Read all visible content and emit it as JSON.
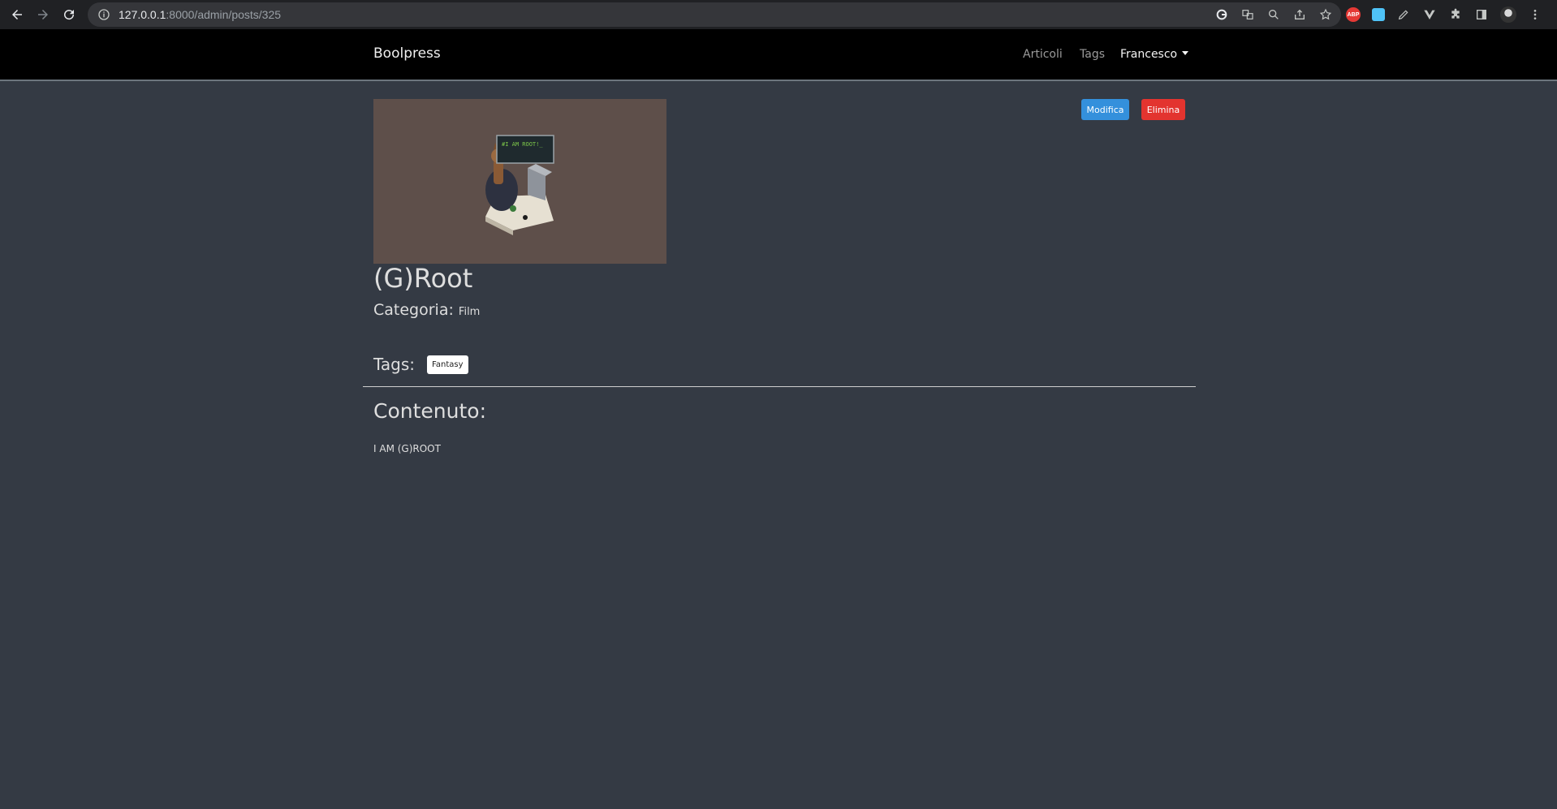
{
  "browser": {
    "url_host": "127.0.0.1",
    "url_rest": ":8000/admin/posts/325",
    "abp_label": "ABP"
  },
  "navbar": {
    "brand": "Boolpress",
    "links": [
      {
        "label": "Articoli"
      },
      {
        "label": "Tags"
      }
    ],
    "user": "Francesco"
  },
  "post": {
    "image_caption": "#I AM ROOT!_",
    "title": "(G)Root",
    "category_label": "Categoria:",
    "category_value": "Film",
    "tags_label": "Tags:",
    "tags": [
      "Fantasy"
    ],
    "content_heading": "Contenuto:",
    "content_body": "I AM (G)ROOT"
  },
  "actions": {
    "edit_label": "Modifica",
    "delete_label": "Elimina"
  },
  "colors": {
    "page_bg": "#343a44",
    "navbar_bg": "#000000",
    "edit": "#3490dc",
    "delete": "#e3342f"
  }
}
